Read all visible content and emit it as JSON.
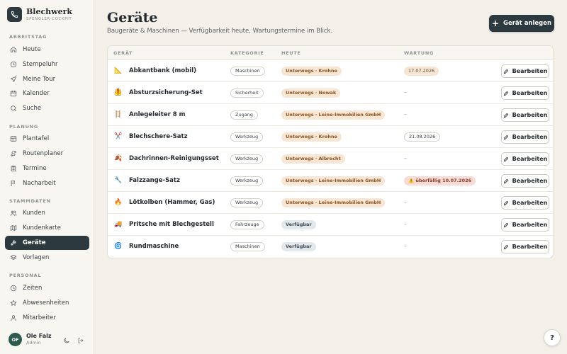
{
  "brand": {
    "name": "Blechwerk",
    "subtitle": "SPENGLER-COCKPIT"
  },
  "sidebar": {
    "sections": [
      {
        "label": "ARBEITSTAG",
        "items": [
          {
            "label": "Heute",
            "icon": "home-icon"
          },
          {
            "label": "Stempeluhr",
            "icon": "clock-icon"
          },
          {
            "label": "Meine Tour",
            "icon": "send-icon"
          },
          {
            "label": "Kalender",
            "icon": "calendar-icon"
          },
          {
            "label": "Suche",
            "icon": "search-icon"
          }
        ]
      },
      {
        "label": "PLANUNG",
        "items": [
          {
            "label": "Plantafel",
            "icon": "board-icon"
          },
          {
            "label": "Routenplaner",
            "icon": "route-icon"
          },
          {
            "label": "Termine",
            "icon": "clipboard-icon"
          },
          {
            "label": "Nacharbeit",
            "icon": "flag-icon"
          }
        ]
      },
      {
        "label": "STAMMDATEN",
        "items": [
          {
            "label": "Kunden",
            "icon": "users-icon"
          },
          {
            "label": "Kundenkarte",
            "icon": "map-icon"
          },
          {
            "label": "Geräte",
            "icon": "hammer-icon",
            "active": true
          },
          {
            "label": "Vorlagen",
            "icon": "layers-icon"
          }
        ]
      },
      {
        "label": "PERSONAL",
        "items": [
          {
            "label": "Zeiten",
            "icon": "clock-icon"
          },
          {
            "label": "Abwesenheiten",
            "icon": "star-icon"
          },
          {
            "label": "Mitarbeiter",
            "icon": "user-icon"
          }
        ]
      }
    ]
  },
  "user": {
    "initials": "OF",
    "name": "Ole Falz",
    "role": "Admin"
  },
  "page": {
    "title": "Geräte",
    "subtitle": "Baugeräte & Maschinen — Verfügbarkeit heute, Wartungstermine im Blick.",
    "add_button": "Gerät anlegen"
  },
  "table": {
    "columns": [
      "GERÄT",
      "KATEGORIE",
      "HEUTE",
      "WARTUNG"
    ],
    "edit_label": "Bearbeiten",
    "rows": [
      {
        "icon": "📐",
        "name": "Abkantbank (mobil)",
        "category": "Maschinen",
        "status": "Unterwegs · Krohne",
        "status_type": "out",
        "maintenance": "17.07.2026",
        "maintenance_type": "warm"
      },
      {
        "icon": "🦺",
        "name": "Absturzsicherung-Set",
        "category": "Sicherheit",
        "status": "Unterwegs · Nowak",
        "status_type": "out",
        "maintenance": "–",
        "maintenance_type": "none"
      },
      {
        "icon": "🪜",
        "name": "Anlegeleiter 8 m",
        "category": "Zugang",
        "status": "Unterwegs · Leine-Immobilien GmbH",
        "status_type": "out",
        "maintenance": "–",
        "maintenance_type": "none"
      },
      {
        "icon": "✂️",
        "name": "Blechschere-Satz",
        "category": "Werkzeug",
        "status": "Unterwegs · Krohne",
        "status_type": "out",
        "maintenance": "21.08.2026",
        "maintenance_type": "plain"
      },
      {
        "icon": "🍂",
        "name": "Dachrinnen-Reinigungsset",
        "category": "Werkzeug",
        "status": "Unterwegs · Albrecht",
        "status_type": "out",
        "maintenance": "–",
        "maintenance_type": "none"
      },
      {
        "icon": "🔧",
        "name": "Falzzange-Satz",
        "category": "Werkzeug",
        "status": "Unterwegs · Leine-Immobilien GmbH",
        "status_type": "out",
        "maintenance": "⚠️ überfällig 10.07.2026",
        "maintenance_type": "over"
      },
      {
        "icon": "🔥",
        "name": "Lötkolben (Hammer, Gas)",
        "category": "Werkzeug",
        "status": "Unterwegs · Leine-Immobilien GmbH",
        "status_type": "out",
        "maintenance": "–",
        "maintenance_type": "none"
      },
      {
        "icon": "🚚",
        "name": "Pritsche mit Blechgestell",
        "category": "Fahrzeuge",
        "status": "Verfügbar",
        "status_type": "free",
        "maintenance": "–",
        "maintenance_type": "none"
      },
      {
        "icon": "🌀",
        "name": "Rundmaschine",
        "category": "Maschinen",
        "status": "Verfügbar",
        "status_type": "free",
        "maintenance": "–",
        "maintenance_type": "none"
      }
    ]
  },
  "help": {
    "label": "?"
  },
  "colors": {
    "primary": "#2c3a40",
    "background": "#f3f0ea",
    "out_chip": "#f6e6d3",
    "free_chip": "#e3e8ec",
    "overdue_chip": "#f7dcd6"
  }
}
